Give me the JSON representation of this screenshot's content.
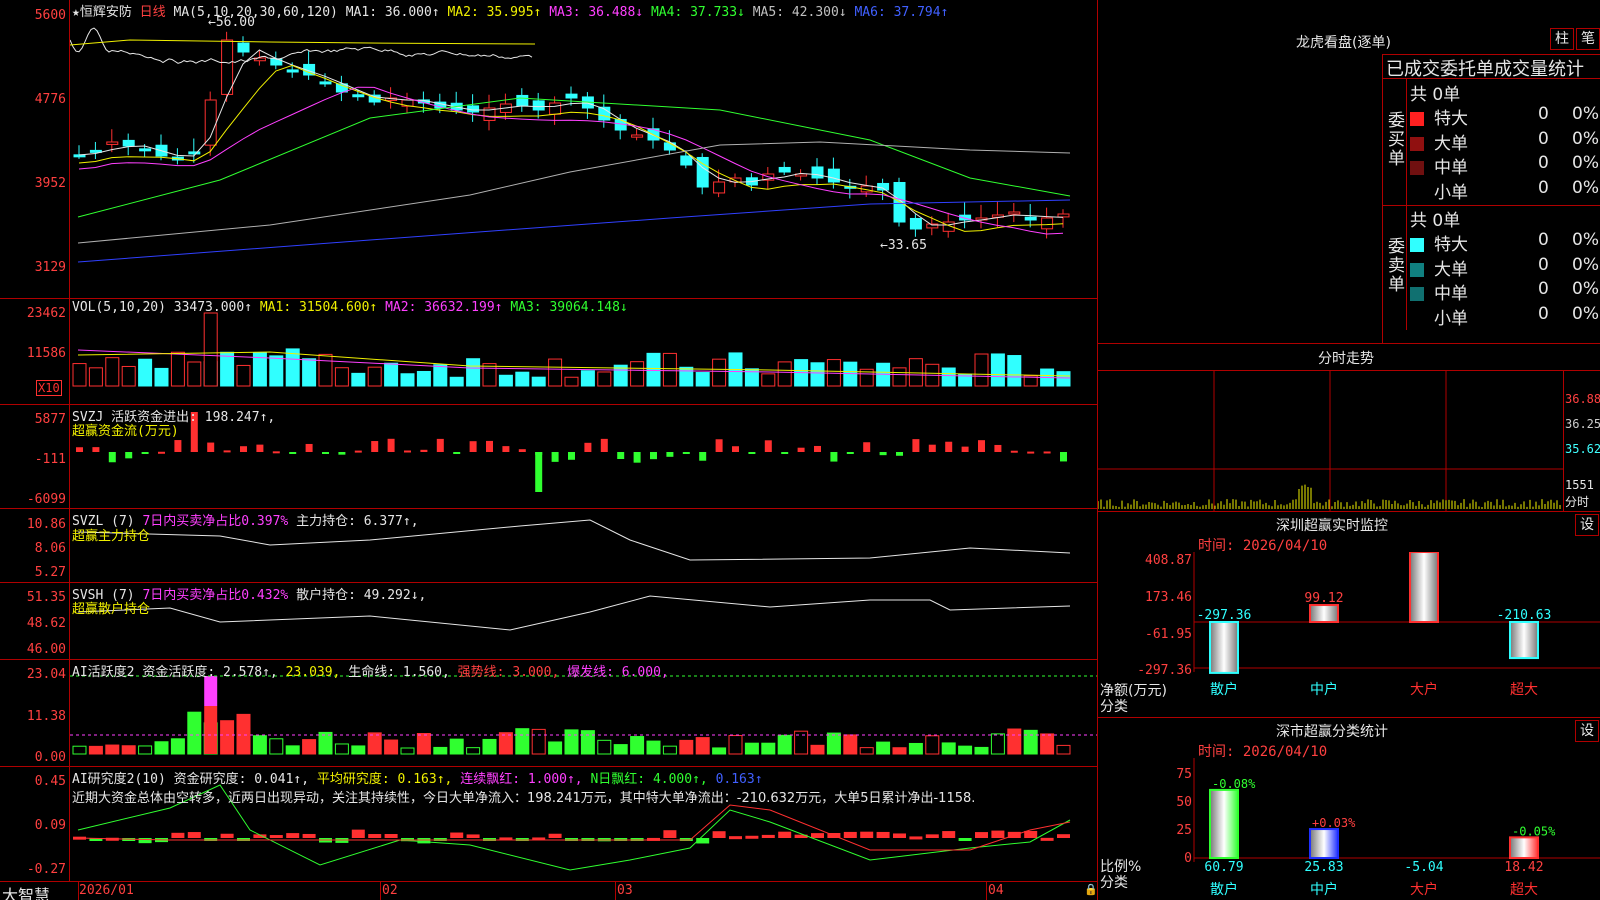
{
  "stock": {
    "name": "恒辉安防",
    "period": "日线",
    "star": "★"
  },
  "colors": {
    "up": "#ff3030",
    "down": "#30ffff",
    "frame": "#b00000",
    "ma1": "#e6e6e6",
    "ma2": "#f0f000",
    "ma3": "#ff40ff",
    "ma4": "#30ff30",
    "ma5": "#b0b0b0",
    "ma6": "#3040ff"
  },
  "main": {
    "legend": {
      "ma": "MA(5,10,20,30,60,120)",
      "ma1": "MA1: 36.000↑",
      "ma2": "MA2: 35.995↑",
      "ma3": "MA3: 36.488↓",
      "ma4": "MA4: 37.733↓",
      "ma5": "MA5: 42.300↓",
      "ma6": "MA6: 37.794↑"
    },
    "yticks": [
      "5600",
      "4776",
      "3952",
      "3129"
    ],
    "high_label": "←56.00",
    "low_label": "←33.65"
  },
  "vol": {
    "legend": {
      "name": "VOL(5,10,20)",
      "val": "33473.000↑",
      "ma1": "MA1: 31504.600↑",
      "ma2": "MA2: 36632.199↑",
      "ma3": "MA3: 39064.148↓"
    },
    "yticks": [
      "23462",
      "11586"
    ],
    "unit": "X10"
  },
  "svzj": {
    "legend": {
      "name": "SVZJ",
      "label": "活跃资金进出: 198.247↑,",
      "title": "超赢资金流(万元)"
    },
    "yticks": [
      "5877",
      "-111",
      "-6099"
    ]
  },
  "svzl": {
    "legend": {
      "name": "SVZL (7)",
      "ratio": "7日内买卖净占比0.397%",
      "hold": "主力持仓: 6.377↑,",
      "title": "超赢主力持仓"
    },
    "yticks": [
      "10.86",
      "8.06",
      "5.27"
    ]
  },
  "svsh": {
    "legend": {
      "name": "SVSH (7)",
      "ratio": "7日内买卖净占比0.432%",
      "hold": "散户持仓: 49.292↓,",
      "title": "超赢散户持仓"
    },
    "yticks": [
      "51.35",
      "48.62",
      "46.00"
    ]
  },
  "ai1": {
    "legend": {
      "name": "AI活跃度2",
      "act": "资金活跃度: 2.578↑,",
      "v2": "23.039,",
      "life": "生命线: 1.560,",
      "strong": "强势线: 3.000,",
      "burst": "爆发线: 6.000,"
    },
    "yticks": [
      "23.04",
      "11.38",
      "0.00"
    ]
  },
  "ai2": {
    "legend": {
      "name": "AI研究度2(10)",
      "res": "资金研究度: 0.041↑,",
      "avg": "平均研究度: 0.163↑,",
      "cont": "连续飘红: 1.000↑,",
      "nday": "N日飘红: 4.000↑,",
      "last": "0.163↑"
    },
    "text": "近期大资金总体由空转多，近两日出现异动，关注其持续性，今日大单净流入：198.241万元，其中特大单净流出：-210.632万元，大单5日累计净出-1158.",
    "yticks": [
      "0.45",
      "0.09",
      "-0.27"
    ]
  },
  "xaxis": {
    "labels": [
      "2026/01",
      "02",
      "03",
      "04"
    ]
  },
  "brand": "大智慧",
  "right": {
    "dragon": {
      "title": "龙虎看盘(逐单)",
      "btn_col": "柱",
      "btn_pen": "笔",
      "sub": "已成交委托单成交量统计",
      "buy": {
        "side": "委买单",
        "total": "共 0单",
        "rows": [
          {
            "label": "特大",
            "v": "0",
            "p": "0%",
            "color": "#ff2020"
          },
          {
            "label": "大单",
            "v": "0",
            "p": "0%",
            "color": "#901010"
          },
          {
            "label": "中单",
            "v": "0",
            "p": "0%",
            "color": "#701010"
          },
          {
            "label": "小单",
            "v": "0",
            "p": "0%",
            "color": "#000000"
          }
        ]
      },
      "sell": {
        "side": "委卖单",
        "total": "共 0单",
        "rows": [
          {
            "label": "特大",
            "v": "0",
            "p": "0%",
            "color": "#30ffff"
          },
          {
            "label": "大单",
            "v": "0",
            "p": "0%",
            "color": "#108080"
          },
          {
            "label": "中单",
            "v": "0",
            "p": "0%",
            "color": "#107070"
          },
          {
            "label": "小单",
            "v": "0",
            "p": "0%",
            "color": "#000000"
          }
        ]
      }
    },
    "intraday": {
      "title": "分时走势",
      "yticks": [
        "36.88",
        "36.25",
        "35.62"
      ],
      "vol_tick": "1551",
      "vol_unit": "分时"
    },
    "sz_monitor": {
      "title": "深圳超赢实时监控",
      "btn": "设",
      "time": "时间: 2026/04/10",
      "yticks": [
        "408.87",
        "173.46",
        "-61.95",
        "-297.36"
      ],
      "ylabel": "净额(万元)",
      "xlabel": "分类",
      "bars": [
        {
          "name": "散户",
          "value": -297.36,
          "label": "-297.36"
        },
        {
          "name": "中户",
          "value": 99.12,
          "label": "99.12"
        },
        {
          "name": "大户",
          "value": 408.87,
          "label": "408.87"
        },
        {
          "name": "超大",
          "value": -210.63,
          "label": "-210.63"
        }
      ]
    },
    "stat": {
      "title": "深市超赢分类统计",
      "btn": "设",
      "time": "时间: 2026/04/10",
      "yticks": [
        "75",
        "50",
        "25",
        "0"
      ],
      "ylabel": "比例%",
      "xlabel": "分类",
      "bars": [
        {
          "name": "散户",
          "value": 60.79,
          "label": "60.79",
          "chg": "-0.08%",
          "color": "#30ff30"
        },
        {
          "name": "中户",
          "value": 25.83,
          "label": "25.83",
          "chg": "+0.03%",
          "color": "#2030ff"
        },
        {
          "name": "大户",
          "value": -5.04,
          "label": "-5.04",
          "chg": "",
          "color": "#30ffff"
        },
        {
          "name": "超大",
          "value": 18.42,
          "label": "18.42",
          "chg": "-0.05%",
          "color": "#ff3030"
        }
      ]
    }
  }
}
